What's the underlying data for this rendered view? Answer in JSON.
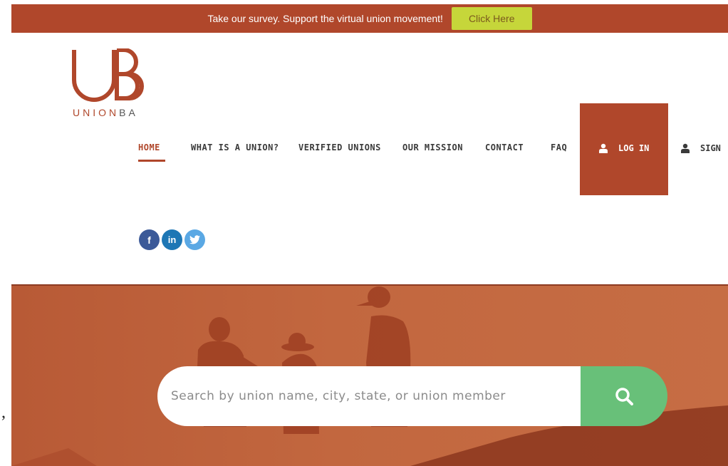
{
  "banner": {
    "text": "Take our survey. Support the virtual union movement!",
    "button_label": "Click Here"
  },
  "logo": {
    "wordmark_prefix": "UNION",
    "wordmark_suffix": "BA",
    "icon": "ub-logo"
  },
  "nav": {
    "items": [
      {
        "label": "HOME",
        "active": true
      },
      {
        "label": "WHAT IS A UNION?",
        "active": false
      },
      {
        "label": "VERIFIED UNIONS",
        "active": false
      },
      {
        "label": "OUR MISSION",
        "active": false
      },
      {
        "label": "CONTACT",
        "active": false
      },
      {
        "label": "FAQ",
        "active": false
      }
    ],
    "login_label": "LOG IN",
    "signup_label": "SIGN"
  },
  "social": [
    {
      "icon": "facebook-icon",
      "glyph": "f"
    },
    {
      "icon": "linkedin-icon",
      "glyph": "in"
    },
    {
      "icon": "twitter-icon",
      "glyph": ""
    }
  ],
  "search": {
    "placeholder": "Search by union name, city, state, or union member",
    "value": "",
    "button_icon": "search-icon"
  },
  "stray_text": ",",
  "colors": {
    "brand": "#b0472b",
    "survey_button": "#c6d63a",
    "search_button": "#68c079",
    "facebook": "#3b5998",
    "linkedin": "#1e77b5",
    "twitter": "#5aa8e4"
  }
}
